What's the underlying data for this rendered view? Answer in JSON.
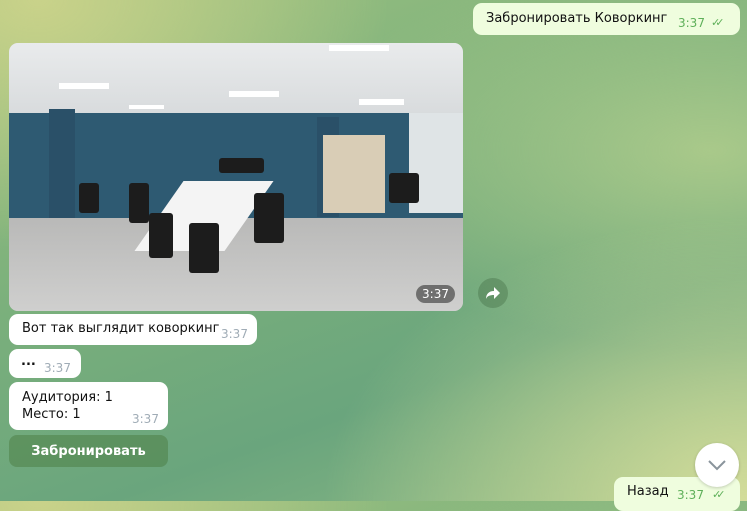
{
  "messages": [
    {
      "text": "Забронировать Коворкинг",
      "time": "3:37",
      "outgoing": true,
      "status": "read"
    },
    {
      "type": "photo",
      "time": "3:37"
    },
    {
      "text": "Вот так выглядит коворкинг",
      "time": "3:37"
    },
    {
      "text": "...",
      "time": "3:37"
    },
    {
      "lines": [
        "Аудитория: 1",
        "Место: 1"
      ],
      "time": "3:37"
    },
    {
      "text": "Назад",
      "time": "3:37",
      "outgoing": true,
      "status": "read"
    }
  ],
  "inline_keyboard": {
    "button": "Забронировать"
  },
  "icons": {
    "forward": "share-arrow-icon",
    "scroll_down": "chevron-down-icon",
    "read": "double-check-icon"
  },
  "colors": {
    "outgoing_bubble": "#effdde",
    "incoming_bubble": "#ffffff",
    "check": "#5fb05a"
  }
}
